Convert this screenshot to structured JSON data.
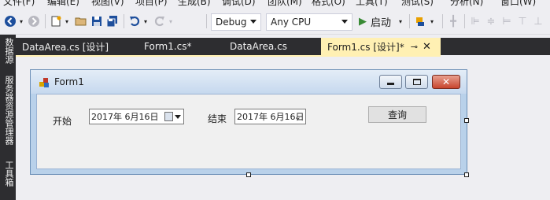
{
  "menu": {
    "items": [
      "文件(F)",
      "编辑(E)",
      "视图(V)",
      "项目(P)",
      "生成(B)",
      "调试(D)",
      "团队(M)",
      "格式(O)",
      "工具(T)",
      "测试(S)",
      "分析(N)",
      "窗口(W)"
    ]
  },
  "toolbar": {
    "configuration": "Debug",
    "platform": "Any CPU",
    "start_label": "启动"
  },
  "left_strip": {
    "tabs": [
      "数据源",
      "服务器资源管理器",
      "工具箱"
    ]
  },
  "doc_tabs": [
    {
      "label": "DataArea.cs [设计]"
    },
    {
      "label": "Form1.cs*"
    },
    {
      "label": "DataArea.cs"
    },
    {
      "label": "Form1.cs [设计]*",
      "active": true
    }
  ],
  "form": {
    "title": "Form1",
    "start_label": "开始",
    "start_date": "2017年  6月16日",
    "end_label": "结束",
    "end_date": "2017年  6月16日",
    "query_button": "查询"
  },
  "colors": {
    "active_tab": "#fff0b3",
    "dark_chrome": "#2d2d30",
    "form_border": "#b9d1ea"
  }
}
